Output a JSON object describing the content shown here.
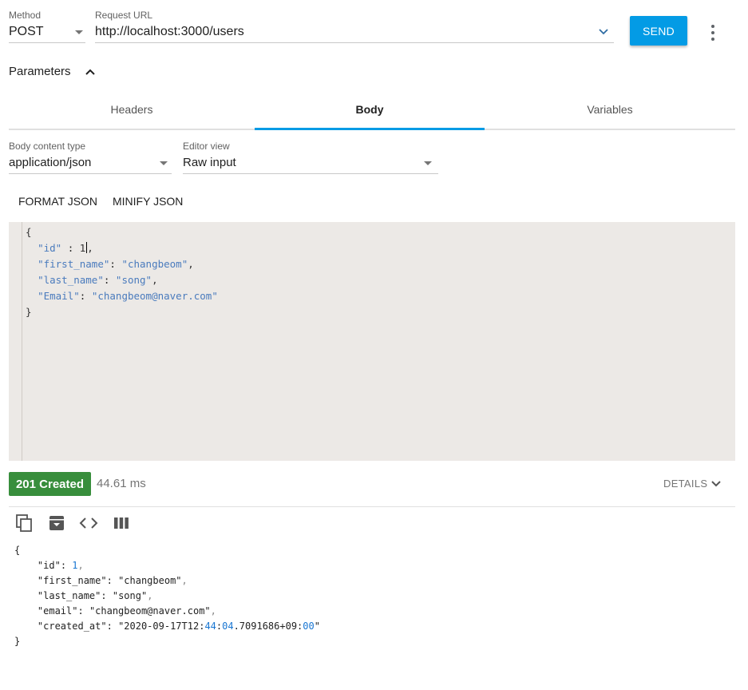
{
  "request": {
    "method_label": "Method",
    "method_value": "POST",
    "url_label": "Request URL",
    "url_value": "http://localhost:3000/users",
    "send_label": "SEND"
  },
  "parameters": {
    "title": "Parameters"
  },
  "tabs": [
    {
      "label": "Headers",
      "active": false
    },
    {
      "label": "Body",
      "active": true
    },
    {
      "label": "Variables",
      "active": false
    }
  ],
  "body_options": {
    "content_type_label": "Body content type",
    "content_type_value": "application/json",
    "editor_view_label": "Editor view",
    "editor_view_value": "Raw input"
  },
  "actions": {
    "format_json": "FORMAT JSON",
    "minify_json": "MINIFY JSON"
  },
  "editor_lines": [
    "{",
    "  \"id\" : 1,",
    "  \"first_name\": \"changbeom\",",
    "  \"last_name\": \"song\",",
    "  \"Email\": \"changbeom@naver.com\"",
    "}"
  ],
  "response": {
    "status": "201 Created",
    "time": "44.61 ms",
    "details_label": "DETAILS",
    "status_color": "#388e3c",
    "toolbar_icons": [
      "copy-icon",
      "archive-icon",
      "code-icon",
      "columns-icon"
    ],
    "body_lines": [
      "{",
      "    \"id\": 1,",
      "    \"first_name\": \"changbeom\",",
      "    \"last_name\": \"song\",",
      "    \"email\": \"changbeom@naver.com\",",
      "    \"created_at\": \"2020-09-17T12:44:04.7091686+09:00\"",
      "}"
    ]
  },
  "colors": {
    "accent": "#039be5",
    "tab_indicator": "#039be5",
    "editor_bg": "#ece9e6",
    "success": "#388e3c"
  }
}
